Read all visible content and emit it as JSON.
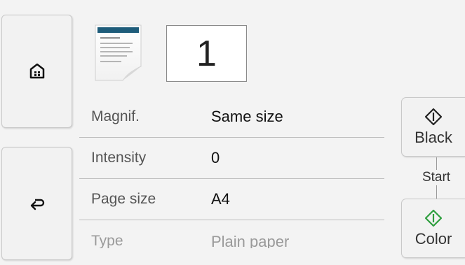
{
  "nav": {
    "home_icon": "home-icon",
    "back_icon": "back-arrow-icon"
  },
  "copies": {
    "count": "1",
    "document_icon": "document-page-icon"
  },
  "settings": [
    {
      "label": "Magnif.",
      "value": "Same size"
    },
    {
      "label": "Intensity",
      "value": "0"
    },
    {
      "label": "Page size",
      "value": "A4"
    },
    {
      "label": "Type",
      "value": "Plain paper"
    }
  ],
  "start": {
    "label": "Start",
    "black_label": "Black",
    "color_label": "Color",
    "black_icon": "start-diamond-icon",
    "color_icon": "start-diamond-icon",
    "black_icon_color": "#222222",
    "color_icon_color": "#2e9e3e"
  }
}
